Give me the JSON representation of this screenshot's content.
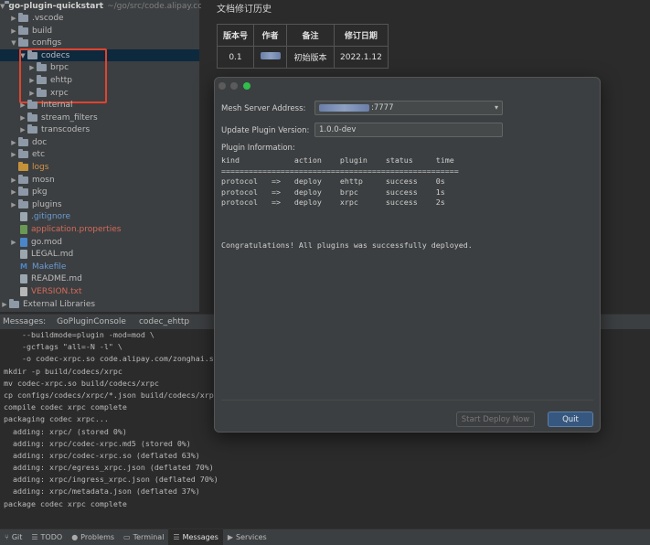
{
  "project": {
    "name": "go-plugin-quickstart",
    "path": "~/go/src/code.alipay.com"
  },
  "tree": [
    {
      "label": ".vscode"
    },
    {
      "label": "build"
    },
    {
      "label": "configs"
    },
    {
      "label": "codecs"
    },
    {
      "label": "brpc"
    },
    {
      "label": "ehttp"
    },
    {
      "label": "xrpc"
    },
    {
      "label": "internal"
    },
    {
      "label": "stream_filters"
    },
    {
      "label": "transcoders"
    },
    {
      "label": "doc"
    },
    {
      "label": "etc"
    },
    {
      "label": "logs"
    },
    {
      "label": "mosn"
    },
    {
      "label": "pkg"
    },
    {
      "label": "plugins"
    },
    {
      "label": ".gitignore"
    },
    {
      "label": "application.properties"
    },
    {
      "label": "go.mod"
    },
    {
      "label": "LEGAL.md"
    },
    {
      "label": "Makefile"
    },
    {
      "label": "README.md"
    },
    {
      "label": "VERSION.txt"
    },
    {
      "label": "External Libraries"
    }
  ],
  "document": {
    "heading": "文档修订历史",
    "table": {
      "headers": [
        "版本号",
        "作者",
        "备注",
        "修订日期"
      ],
      "rows": [
        [
          "0.1",
          "",
          "初始版本",
          "2022.1.12"
        ]
      ]
    }
  },
  "messages": {
    "label": "Messages:",
    "tabs": [
      "GoPluginConsole",
      "codec_ehttp"
    ]
  },
  "console_lines": [
    "    --buildmode=plugin -mod=mod \\",
    "    -gcflags \"all=-N -l\" \\",
    "    -o codec-xrpc.so code.alipay.com/zonghai.szh,",
    "mkdir -p build/codecs/xrpc",
    "mv codec-xrpc.so build/codecs/xrpc",
    "cp configs/codecs/xrpc/*.json build/codecs/xrpc",
    "compile codec xrpc complete",
    "packaging codec xrpc...",
    "  adding: xrpc/ (stored 0%)",
    "  adding: xrpc/codec-xrpc.md5 (stored 0%)",
    "  adding: xrpc/codec-xrpc.so (deflated 63%)",
    "  adding: xrpc/egress_xrpc.json (deflated 70%)",
    "  adding: xrpc/ingress_xrpc.json (deflated 70%)",
    "  adding: xrpc/metadata.json (deflated 37%)",
    "package codec xrpc complete"
  ],
  "bottom_bar": [
    {
      "label": "Git",
      "icon": "⑂"
    },
    {
      "label": "TODO",
      "icon": "☰"
    },
    {
      "label": "Problems",
      "icon": "●"
    },
    {
      "label": "Terminal",
      "icon": "▭"
    },
    {
      "label": "Messages",
      "icon": "☰"
    },
    {
      "label": "Services",
      "icon": "▶"
    }
  ],
  "dialog": {
    "server_label": "Mesh Server Address:",
    "server_value": ":7777",
    "version_label": "Update Plugin Version:",
    "version_value": "1.0.0-dev",
    "info_label": "Plugin Information:",
    "output_lines": [
      "kind            action    plugin    status     time",
      "====================================================",
      "protocol   =>   deploy    ehttp     success    0s",
      "protocol   =>   deploy    brpc      success    1s",
      "protocol   =>   deploy    xrpc      success    2s",
      "",
      "",
      "",
      "Congratulations! All plugins was successfully deployed."
    ],
    "deploy_button": "Start Deploy Now",
    "quit_button": "Quit"
  }
}
